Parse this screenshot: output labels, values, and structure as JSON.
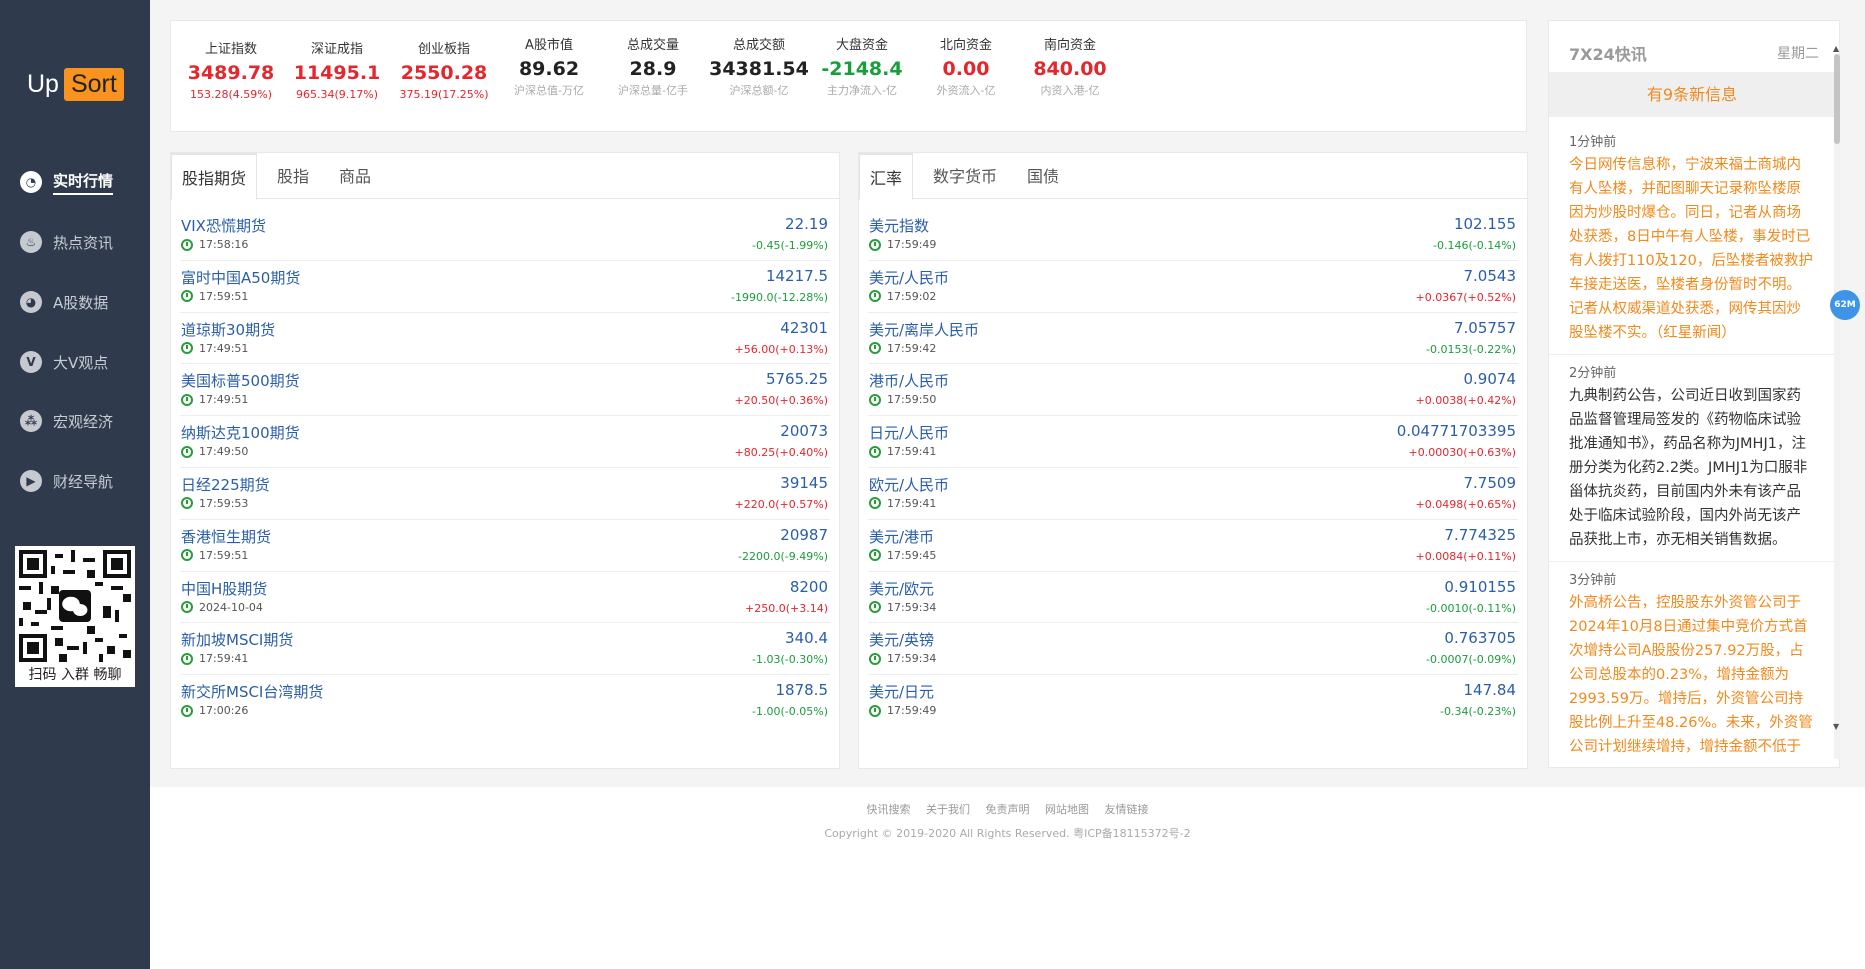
{
  "brand": {
    "logo_left": "Up",
    "logo_right": "Sort",
    "accent": "#f7931e",
    "sidebar_bg": "#2f3b4c"
  },
  "nav": [
    {
      "label": "实时行情",
      "icon": "dashboard-icon",
      "active": true
    },
    {
      "label": "热点资讯",
      "icon": "fire-icon",
      "active": false
    },
    {
      "label": "A股数据",
      "icon": "pie-chart-icon",
      "active": false
    },
    {
      "label": "大V观点",
      "icon": "v-badge-icon",
      "active": false
    },
    {
      "label": "宏观经济",
      "icon": "network-icon",
      "active": false
    },
    {
      "label": "财经导航",
      "icon": "play-icon",
      "active": false
    }
  ],
  "qr": {
    "caption": "扫码 入群 畅聊"
  },
  "tickers": [
    {
      "name": "上证指数",
      "value": "3489.78",
      "sub": "153.28(4.59%)",
      "color": "red"
    },
    {
      "name": "深证成指",
      "value": "11495.1",
      "sub": "965.34(9.17%)",
      "color": "red"
    },
    {
      "name": "创业板指",
      "value": "2550.28",
      "sub": "375.19(17.25%)",
      "color": "red"
    },
    {
      "name": "A股市值",
      "value": "89.62",
      "sub": "沪深总值-万亿",
      "color": "black"
    },
    {
      "name": "总成交量",
      "value": "28.9",
      "sub": "沪深总量-亿手",
      "color": "black"
    },
    {
      "name": "总成交额",
      "value": "34381.54",
      "sub": "沪深总额-亿",
      "color": "black"
    },
    {
      "name": "大盘资金",
      "value": "-2148.4",
      "sub": "主力净流入-亿",
      "color": "green"
    },
    {
      "name": "北向资金",
      "value": "0.00",
      "sub": "外资流入-亿",
      "color": "red"
    },
    {
      "name": "南向资金",
      "value": "840.00",
      "sub": "内资入港-亿",
      "color": "red"
    }
  ],
  "left_panel": {
    "tabs": [
      "股指期货",
      "股指",
      "商品"
    ],
    "rows": [
      {
        "name": "VIX恐慌期货",
        "value": "22.19",
        "time": "17:58:16",
        "change": "-0.45(-1.99%)",
        "dir": "green"
      },
      {
        "name": "富时中国A50期货",
        "value": "14217.5",
        "time": "17:59:51",
        "change": "-1990.0(-12.28%)",
        "dir": "green"
      },
      {
        "name": "道琼斯30期货",
        "value": "42301",
        "time": "17:49:51",
        "change": "+56.00(+0.13%)",
        "dir": "red"
      },
      {
        "name": "美国标普500期货",
        "value": "5765.25",
        "time": "17:49:51",
        "change": "+20.50(+0.36%)",
        "dir": "red"
      },
      {
        "name": "纳斯达克100期货",
        "value": "20073",
        "time": "17:49:50",
        "change": "+80.25(+0.40%)",
        "dir": "red"
      },
      {
        "name": "日经225期货",
        "value": "39145",
        "time": "17:59:53",
        "change": "+220.0(+0.57%)",
        "dir": "red"
      },
      {
        "name": "香港恒生期货",
        "value": "20987",
        "time": "17:59:51",
        "change": "-2200.0(-9.49%)",
        "dir": "green"
      },
      {
        "name": "中国H股期货",
        "value": "8200",
        "time": "2024-10-04",
        "change": "+250.0(+3.14)",
        "dir": "red"
      },
      {
        "name": "新加坡MSCI期货",
        "value": "340.4",
        "time": "17:59:41",
        "change": "-1.03(-0.30%)",
        "dir": "green"
      },
      {
        "name": "新交所MSCI台湾期货",
        "value": "1878.5",
        "time": "17:00:26",
        "change": "-1.00(-0.05%)",
        "dir": "green"
      }
    ]
  },
  "right_panel": {
    "tabs": [
      "汇率",
      "数字货币",
      "国债"
    ],
    "rows": [
      {
        "name": "美元指数",
        "value": "102.155",
        "time": "17:59:49",
        "change": "-0.146(-0.14%)",
        "dir": "green"
      },
      {
        "name": "美元/人民币",
        "value": "7.0543",
        "time": "17:59:02",
        "change": "+0.0367(+0.52%)",
        "dir": "red"
      },
      {
        "name": "美元/离岸人民币",
        "value": "7.05757",
        "time": "17:59:42",
        "change": "-0.0153(-0.22%)",
        "dir": "green"
      },
      {
        "name": "港币/人民币",
        "value": "0.9074",
        "time": "17:59:50",
        "change": "+0.0038(+0.42%)",
        "dir": "red"
      },
      {
        "name": "日元/人民币",
        "value": "0.04771703395",
        "time": "17:59:41",
        "change": "+0.00030(+0.63%)",
        "dir": "red"
      },
      {
        "name": "欧元/人民币",
        "value": "7.7509",
        "time": "17:59:41",
        "change": "+0.0498(+0.65%)",
        "dir": "red"
      },
      {
        "name": "美元/港币",
        "value": "7.774325",
        "time": "17:59:45",
        "change": "+0.0084(+0.11%)",
        "dir": "red"
      },
      {
        "name": "美元/欧元",
        "value": "0.910155",
        "time": "17:59:34",
        "change": "-0.0010(-0.11%)",
        "dir": "green"
      },
      {
        "name": "美元/英镑",
        "value": "0.763705",
        "time": "17:59:34",
        "change": "-0.0007(-0.09%)",
        "dir": "green"
      },
      {
        "name": "美元/日元",
        "value": "147.84",
        "time": "17:59:49",
        "change": "-0.34(-0.23%)",
        "dir": "green"
      }
    ]
  },
  "news": {
    "title": "7X24快讯",
    "day": "星期二",
    "banner": "有9条新信息",
    "items": [
      {
        "time": "1分钟前",
        "text": "今日网传信息称，宁波来福士商城内有人坠楼，并配图聊天记录称坠楼原因为炒股时爆仓。同日，记者从商场处获悉，8日中午有人坠楼，事发时已有人拨打110及120，后坠楼者被救护车接走送医，坠楼者身份暂时不明。记者从权威渠道处获悉，网传其因炒股坠楼不实。（红星新闻）",
        "color": "orange"
      },
      {
        "time": "2分钟前",
        "text": "九典制药公告，公司近日收到国家药品监督管理局签发的《药物临床试验批准通知书》，药品名称为JMHJ1，注册分类为化药2.2类。JMHJ1为口服非甾体抗炎药，目前国内外未有该产品处于临床试验阶段，国内外尚无该产品获批上市，亦无相关销售数据。",
        "color": "dark"
      },
      {
        "time": "3分钟前",
        "text": "外高桥公告，控股股东外资管公司于2024年10月8日通过集中竞价方式首次增持公司A股股份257.92万股，占公司总股本的0.23%，增持金额为2993.59万。增持后，外资管公司持股比例上升至48.26%。未来，外资管公司计划继续增持，增持金额不低于",
        "color": "orange"
      }
    ]
  },
  "badge": "62M",
  "footer": {
    "links": [
      "快讯搜索",
      "关于我们",
      "免责声明",
      "网站地图",
      "友情链接"
    ],
    "copyright": "Copyright © 2019-2020 All Rights Reserved. 粤ICP备18115372号-2"
  }
}
